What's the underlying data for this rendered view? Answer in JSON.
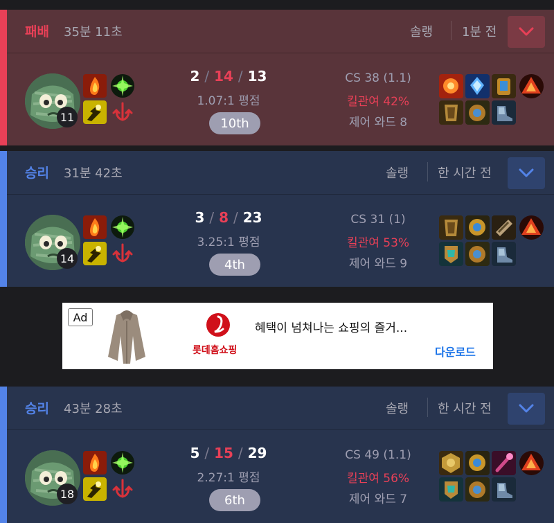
{
  "matches": [
    {
      "result": "패배",
      "duration": "35분 11초",
      "queue": "솔랭",
      "time_ago": "1분 전",
      "champion_icon": "amumu-champion",
      "champion_level": "11",
      "spells": [
        "ignite-icon",
        "flash-icon"
      ],
      "runes": [
        "keystone-rune-icon",
        "secondary-rune-icon"
      ],
      "kills": "2",
      "deaths": "14",
      "assists": "13",
      "kda_ratio": "1.07:1 평점",
      "rank": "10th",
      "cs": "CS 38 (1.1)",
      "kill_participation": "킬관여 42%",
      "control_wards": "제어 와드 8",
      "items": [
        "sunfire-aegis-icon",
        "frozen-heart-icon",
        "jak-sho-icon",
        "oracle-lens-icon",
        "thornmail-icon",
        "demonic-embrace-icon",
        "mercury-treads-icon"
      ]
    },
    {
      "result": "승리",
      "duration": "31분 42초",
      "queue": "솔랭",
      "time_ago": "한 시간 전",
      "champion_icon": "amumu-champion",
      "champion_level": "14",
      "spells": [
        "ignite-icon",
        "flash-icon"
      ],
      "runes": [
        "keystone-rune-icon",
        "secondary-rune-icon"
      ],
      "kills": "3",
      "deaths": "8",
      "assists": "23",
      "kda_ratio": "3.25:1 평점",
      "rank": "4th",
      "cs": "CS 31 (1)",
      "kill_participation": "킬관여 53%",
      "control_wards": "제어 와드 9",
      "items": [
        "thornmail-icon",
        "zhonyas-icon",
        "plated-steelcaps-icon",
        "oracle-lens-icon",
        "abyssal-mask-icon",
        "demonic-embrace-icon",
        "mercury-treads-icon"
      ]
    },
    {
      "result": "승리",
      "duration": "43분 28초",
      "queue": "솔랭",
      "time_ago": "한 시간 전",
      "champion_icon": "amumu-champion",
      "champion_level": "18",
      "spells": [
        "ignite-icon",
        "flash-icon"
      ],
      "runes": [
        "keystone-rune-icon",
        "secondary-rune-icon"
      ],
      "kills": "5",
      "deaths": "15",
      "assists": "29",
      "kda_ratio": "2.27:1 평점",
      "rank": "6th",
      "cs": "CS 49 (1.1)",
      "kill_participation": "킬관여 56%",
      "control_wards": "제어 와드 7",
      "items": [
        "gargoyle-stoneplate-icon",
        "zhonyas-icon",
        "void-staff-icon",
        "oracle-lens-icon",
        "abyssal-mask-icon",
        "demonic-embrace-icon",
        "mercury-treads-icon"
      ]
    }
  ],
  "ad": {
    "badge": "Ad",
    "brand": "롯데홈쇼핑",
    "title": "혜택이 넘쳐나는 쇼핑의 즐거...",
    "cta": "다운로드",
    "product_icon": "fur-jacket-image",
    "logo_icon": "lotte-logo-icon"
  },
  "colors": {
    "loss_bg": "#59343a",
    "loss_accent": "#e84057",
    "win_bg": "#28344e",
    "win_accent": "#5383e8",
    "page_bg": "#1c1c1f"
  }
}
